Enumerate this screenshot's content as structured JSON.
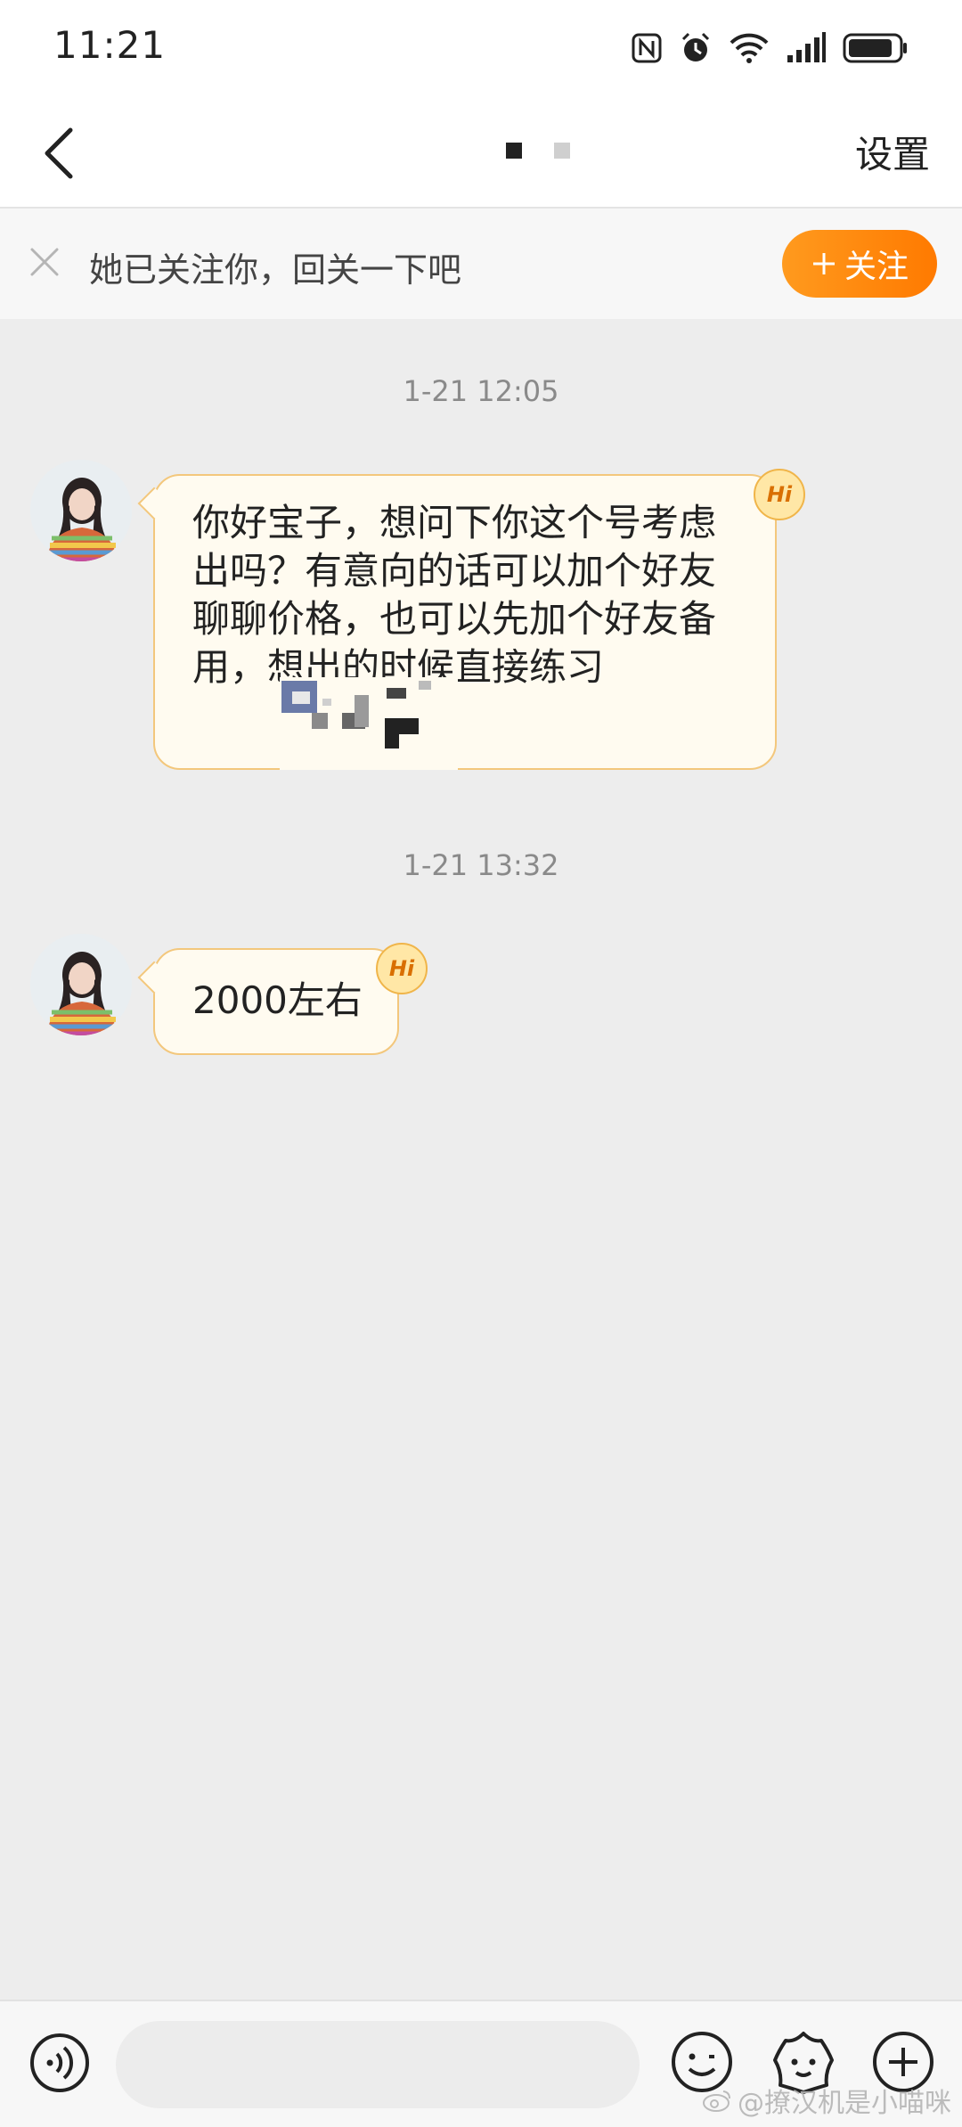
{
  "status_bar": {
    "time": "11:21",
    "icons": [
      "nfc-icon",
      "alarm-icon",
      "wifi-icon",
      "signal-icon",
      "battery-icon"
    ]
  },
  "nav": {
    "back_icon": "chevron-left-icon",
    "settings_label": "设置",
    "page_indicator": {
      "count": 2,
      "active_index": 0
    }
  },
  "banner": {
    "text": "她已关注你，回关一下吧",
    "follow_label": "关注",
    "close_icon": "close-icon"
  },
  "messages": [
    {
      "timestamp": "1-21 12:05",
      "text": "你好宝子，想问下你这个号考虑出吗？有意向的话可以加个好友聊聊价格，也可以先加个好友备用，想出的时候直接练习",
      "badge": "Hi"
    },
    {
      "timestamp": "1-21 13:32",
      "text": "2000左右",
      "badge": "Hi"
    }
  ],
  "input_bar": {
    "icons": [
      "voice-icon",
      "emoji-icon",
      "sticker-icon",
      "plus-icon"
    ],
    "placeholder": ""
  },
  "watermark": "@撩汉机是小喵咪",
  "colors": {
    "accent": "#ff8a00",
    "bubble_bg": "#fffbf0",
    "bubble_border": "#f3c77c",
    "chat_bg": "#ededed"
  }
}
